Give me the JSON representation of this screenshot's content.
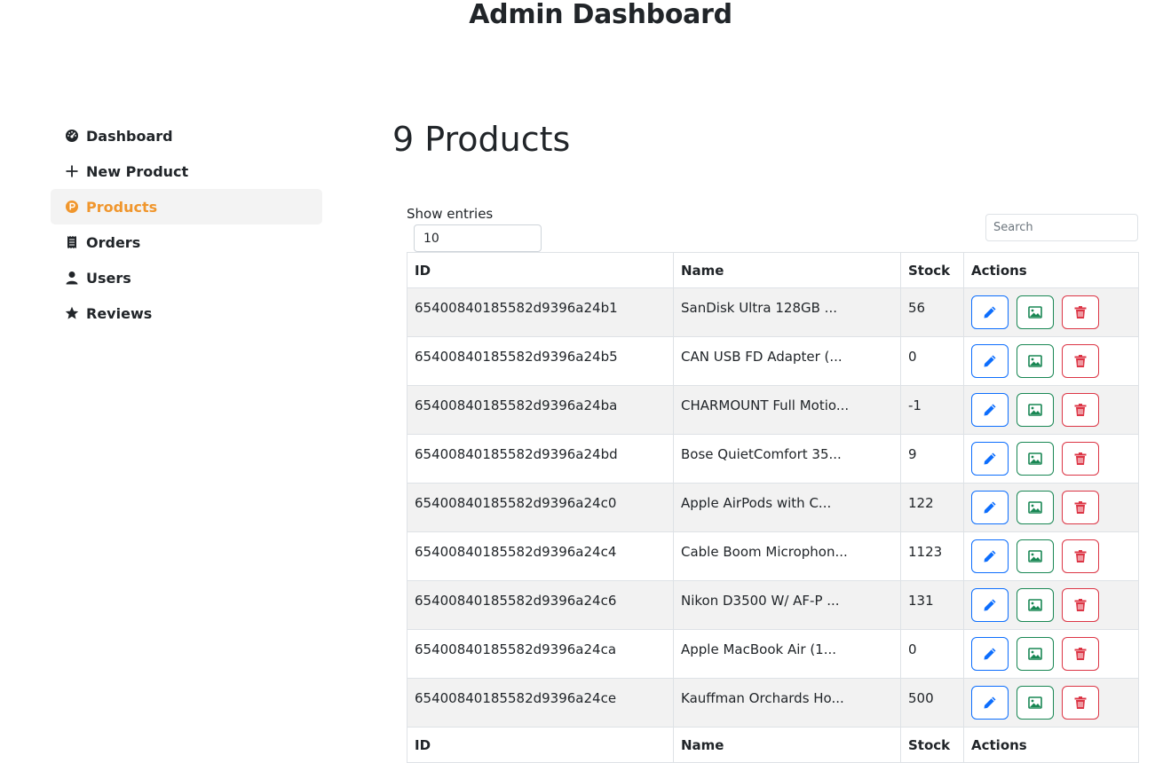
{
  "header": {
    "title": "Admin Dashboard"
  },
  "sidebar": {
    "items": [
      {
        "label": "Dashboard",
        "icon": "dashboard-icon"
      },
      {
        "label": "New Product",
        "icon": "plus-icon"
      },
      {
        "label": "Products",
        "icon": "product-icon",
        "active": true
      },
      {
        "label": "Orders",
        "icon": "receipt-icon"
      },
      {
        "label": "Users",
        "icon": "user-icon"
      },
      {
        "label": "Reviews",
        "icon": "star-icon"
      }
    ]
  },
  "main": {
    "heading": "9 Products",
    "show_entries_label": "Show entries",
    "entries_value": "10",
    "search_placeholder": "Search",
    "columns": [
      "ID",
      "Name",
      "Stock",
      "Actions"
    ],
    "rows": [
      {
        "id": "65400840185582d9396a24b1",
        "name": "SanDisk Ultra 128GB ...",
        "stock": "56"
      },
      {
        "id": "65400840185582d9396a24b5",
        "name": "CAN USB FD Adapter (...",
        "stock": "0"
      },
      {
        "id": "65400840185582d9396a24ba",
        "name": "CHARMOUNT Full Motio...",
        "stock": "-1"
      },
      {
        "id": "65400840185582d9396a24bd",
        "name": "Bose QuietComfort 35...",
        "stock": "9"
      },
      {
        "id": "65400840185582d9396a24c0",
        "name": "Apple AirPods with C...",
        "stock": "122"
      },
      {
        "id": "65400840185582d9396a24c4",
        "name": "Cable Boom Microphon...",
        "stock": "1123"
      },
      {
        "id": "65400840185582d9396a24c6",
        "name": "Nikon D3500 W/ AF-P ...",
        "stock": "131"
      },
      {
        "id": "65400840185582d9396a24ca",
        "name": "Apple MacBook Air (1...",
        "stock": "0"
      },
      {
        "id": "65400840185582d9396a24ce",
        "name": "Kauffman Orchards Ho...",
        "stock": "500"
      }
    ]
  },
  "colors": {
    "accent": "#f0962d",
    "edit": "#0d6efd",
    "image": "#198754",
    "delete": "#dc3545",
    "stripe": "#f2f2f2"
  }
}
